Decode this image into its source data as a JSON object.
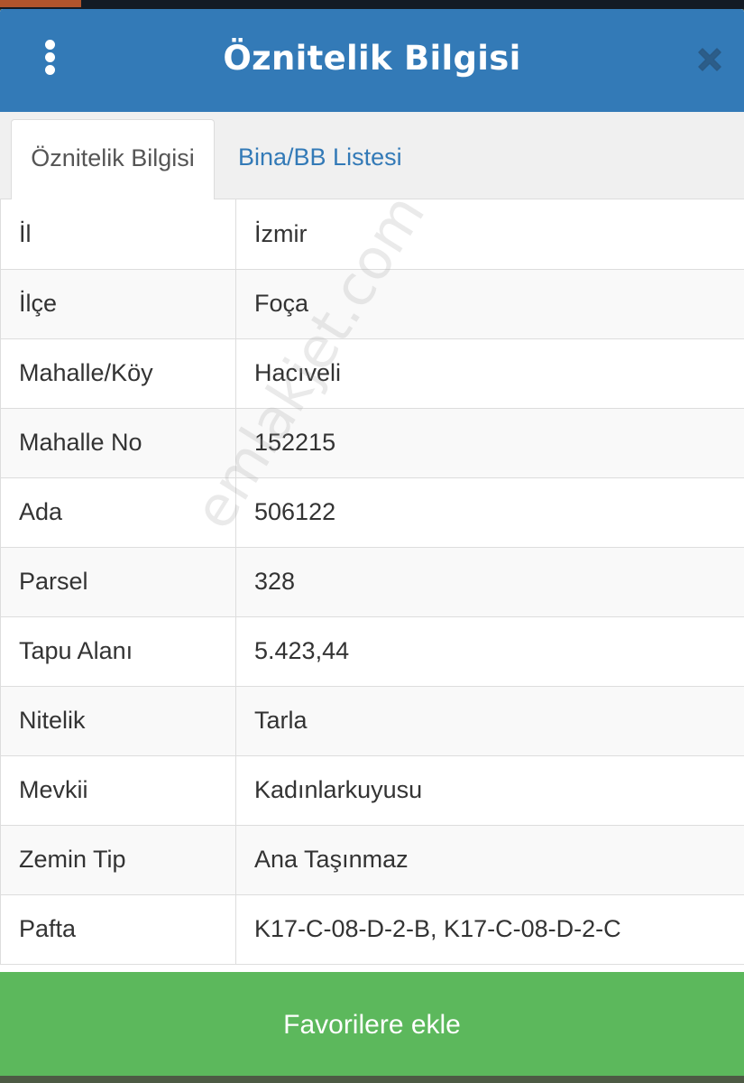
{
  "header": {
    "title": "Öznitelik Bilgisi",
    "menu_icon": "vertical-ellipsis-icon",
    "close_icon": "close-icon",
    "background_color": "#337ab7"
  },
  "tabs": [
    {
      "label": "Öznitelik Bilgisi",
      "active": true
    },
    {
      "label": "Bina/BB Listesi",
      "active": false
    }
  ],
  "attributes": [
    {
      "key": "İl",
      "value": "İzmir"
    },
    {
      "key": "İlçe",
      "value": "Foça"
    },
    {
      "key": "Mahalle/Köy",
      "value": "Hacıveli"
    },
    {
      "key": "Mahalle No",
      "value": "152215"
    },
    {
      "key": "Ada",
      "value": "506122"
    },
    {
      "key": "Parsel",
      "value": "328"
    },
    {
      "key": "Tapu Alanı",
      "value": "5.423,44"
    },
    {
      "key": "Nitelik",
      "value": "Tarla"
    },
    {
      "key": "Mevkii",
      "value": "Kadınlarkuyusu"
    },
    {
      "key": "Zemin Tip",
      "value": "Ana Taşınmaz"
    },
    {
      "key": "Pafta",
      "value": "K17-C-08-D-2-B, K17-C-08-D-2-C"
    }
  ],
  "favorite_button": {
    "label": "Favorilere ekle",
    "color": "#5cb85c"
  },
  "watermark": "emlakjet.com"
}
